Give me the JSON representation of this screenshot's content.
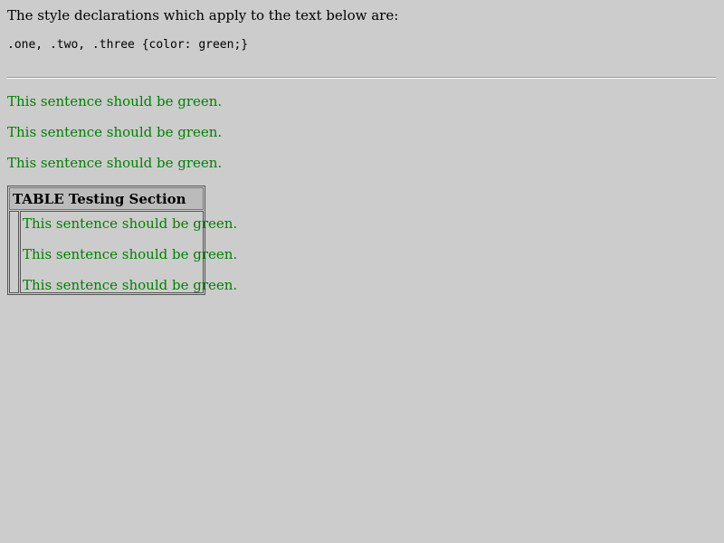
{
  "intro_text": "The style declarations which apply to the text below are:",
  "code_text": ".one, .two, .three {color: green;}",
  "sentences": [
    "This sentence should be green.",
    "This sentence should be green.",
    "This sentence should be green."
  ],
  "table": {
    "header": "TABLE Testing Section",
    "sentences": [
      "This sentence should be green.",
      "This sentence should be green.",
      "This sentence should be green."
    ]
  },
  "colors": {
    "background": "#cccccc",
    "text": "#000000",
    "green": "#008000"
  }
}
